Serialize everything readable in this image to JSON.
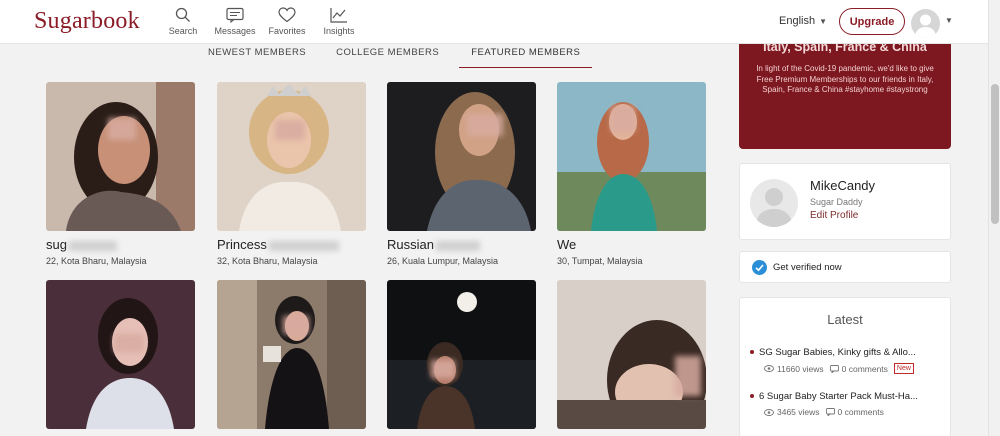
{
  "header": {
    "logo": "Sugarbook",
    "nav": [
      {
        "label": "Search",
        "icon": "search-icon"
      },
      {
        "label": "Messages",
        "icon": "messages-icon"
      },
      {
        "label": "Favorites",
        "icon": "heart-icon"
      },
      {
        "label": "Insights",
        "icon": "insights-chart-icon"
      }
    ],
    "language": "English",
    "upgrade_label": "Upgrade"
  },
  "tabs": [
    "NEWEST MEMBERS",
    "COLLEGE MEMBERS",
    "FEATURED MEMBERS"
  ],
  "active_tab": "FEATURED MEMBERS",
  "members": [
    {
      "name": "sug",
      "location": "22, Kota Bharu, Malaysia"
    },
    {
      "name": "Princess",
      "location": "32, Kota Bharu, Malaysia"
    },
    {
      "name": "Russian",
      "location": "26, Kuala Lumpur, Malaysia"
    },
    {
      "name": "We",
      "location": "30, Tumpat, Malaysia"
    }
  ],
  "promo": {
    "heading": "Italy, Spain, France & China",
    "body": "In light of the Covid-19 pandemic, we'd like to give Free Premium Memberships to our friends in Italy, Spain, France & China #stayhome #staystrong"
  },
  "profile": {
    "name": "MikeCandy",
    "role": "Sugar Daddy",
    "edit_label": "Edit Profile"
  },
  "verify": {
    "label": "Get verified now"
  },
  "latest": {
    "title": "Latest",
    "posts": [
      {
        "title": "SG Sugar Babies, Kinky gifts & Allo...",
        "views": "11660 views",
        "comments": "0 comments",
        "badge": "New"
      },
      {
        "title": "6 Sugar Baby Starter Pack Must-Ha...",
        "views": "3465 views",
        "comments": "0 comments"
      }
    ]
  },
  "colors": {
    "brand": "#8a1c26",
    "accent_blue": "#2a8fd6"
  }
}
